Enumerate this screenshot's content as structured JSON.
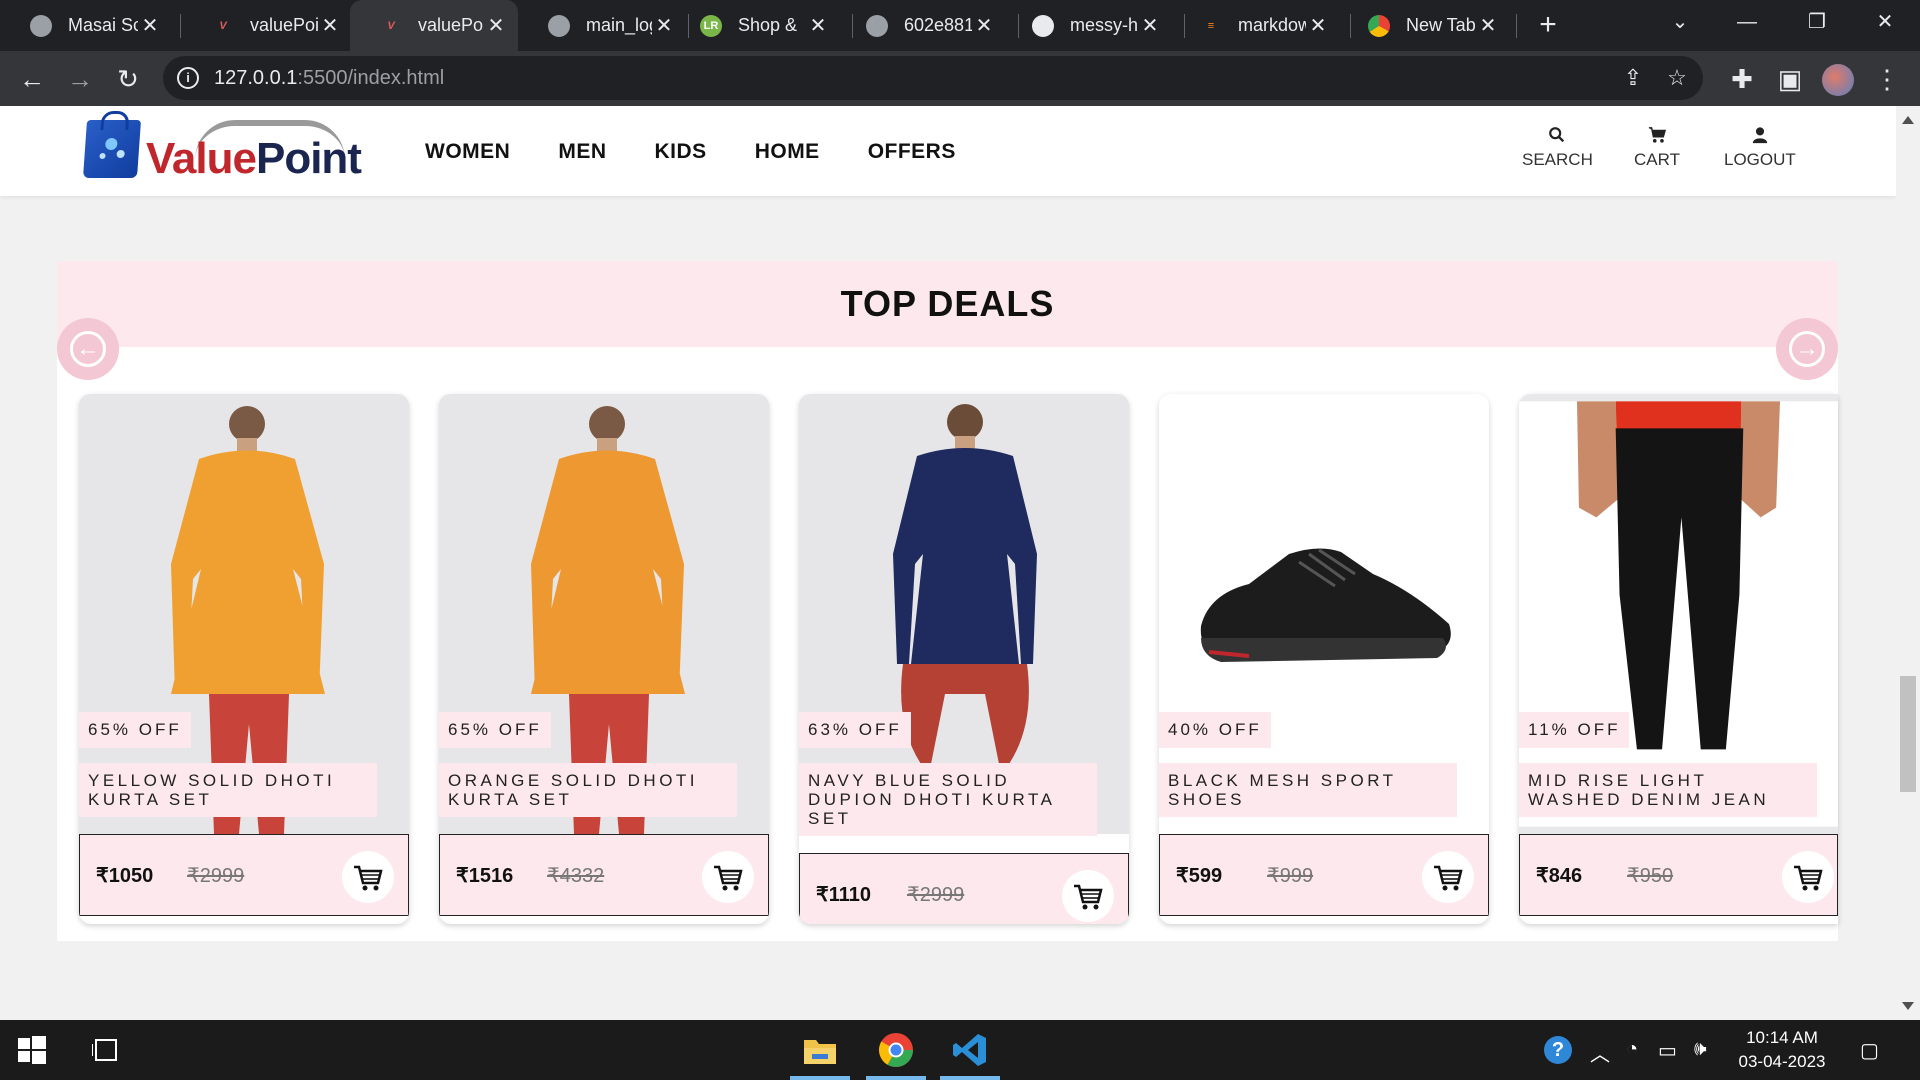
{
  "browser": {
    "tabs": [
      {
        "title": "Masai Sc",
        "favicon": "globe-icon",
        "active": false
      },
      {
        "title": "valuePoi",
        "favicon": "valuepoint-icon",
        "active": false
      },
      {
        "title": "valuePoi",
        "favicon": "valuepoint-icon",
        "active": true
      },
      {
        "title": "main_log",
        "favicon": "globe-icon",
        "active": false
      },
      {
        "title": "Shop & ",
        "favicon": "lr-icon",
        "active": false
      },
      {
        "title": "602e881",
        "favicon": "globe-icon",
        "active": false
      },
      {
        "title": "messy-h",
        "favicon": "github-icon",
        "active": false
      },
      {
        "title": "markdow",
        "favicon": "stackoverflow-icon",
        "active": false
      },
      {
        "title": "New Tab",
        "favicon": "chrome-icon",
        "active": false
      }
    ],
    "url_host": "127.0.0.1",
    "url_rest": ":5500/index.html"
  },
  "site": {
    "logo_value": "Value",
    "logo_point": "Point",
    "nav": [
      "WOMEN",
      "MEN",
      "KIDS",
      "HOME",
      "OFFERS"
    ],
    "actions": {
      "search": "SEARCH",
      "cart": "CART",
      "logout": "LOGOUT"
    }
  },
  "deals": {
    "title": "TOP DEALS",
    "products": [
      {
        "discount": "65% OFF",
        "name": "YELLOW SOLID DHOTI KURTA SET",
        "price": "₹1050",
        "old_price": "₹2999",
        "image": "yellow-kurta"
      },
      {
        "discount": "65% OFF",
        "name": "ORANGE SOLID DHOTI KURTA SET",
        "price": "₹1516",
        "old_price": "₹4332",
        "image": "orange-kurta"
      },
      {
        "discount": "63% OFF",
        "name": "NAVY BLUE SOLID DUPION DHOTI KURTA SET",
        "price": "₹1110",
        "old_price": "₹2999",
        "image": "navy-kurta"
      },
      {
        "discount": "40% OFF",
        "name": "BLACK MESH SPORT SHOES",
        "price": "₹599",
        "old_price": "₹999",
        "image": "black-shoes"
      },
      {
        "discount": "11% OFF",
        "name": "MID RISE LIGHT WASHED DENIM JEAN",
        "price": "₹846",
        "old_price": "₹950",
        "image": "black-jeans"
      }
    ]
  },
  "taskbar": {
    "time": "10:14 AM",
    "date": "03-04-2023"
  },
  "colors": {
    "accent_pink": "#fde8ee",
    "arrow_pink": "#f3c7d3",
    "brand_red": "#c0272d",
    "brand_navy": "#1a2550"
  }
}
